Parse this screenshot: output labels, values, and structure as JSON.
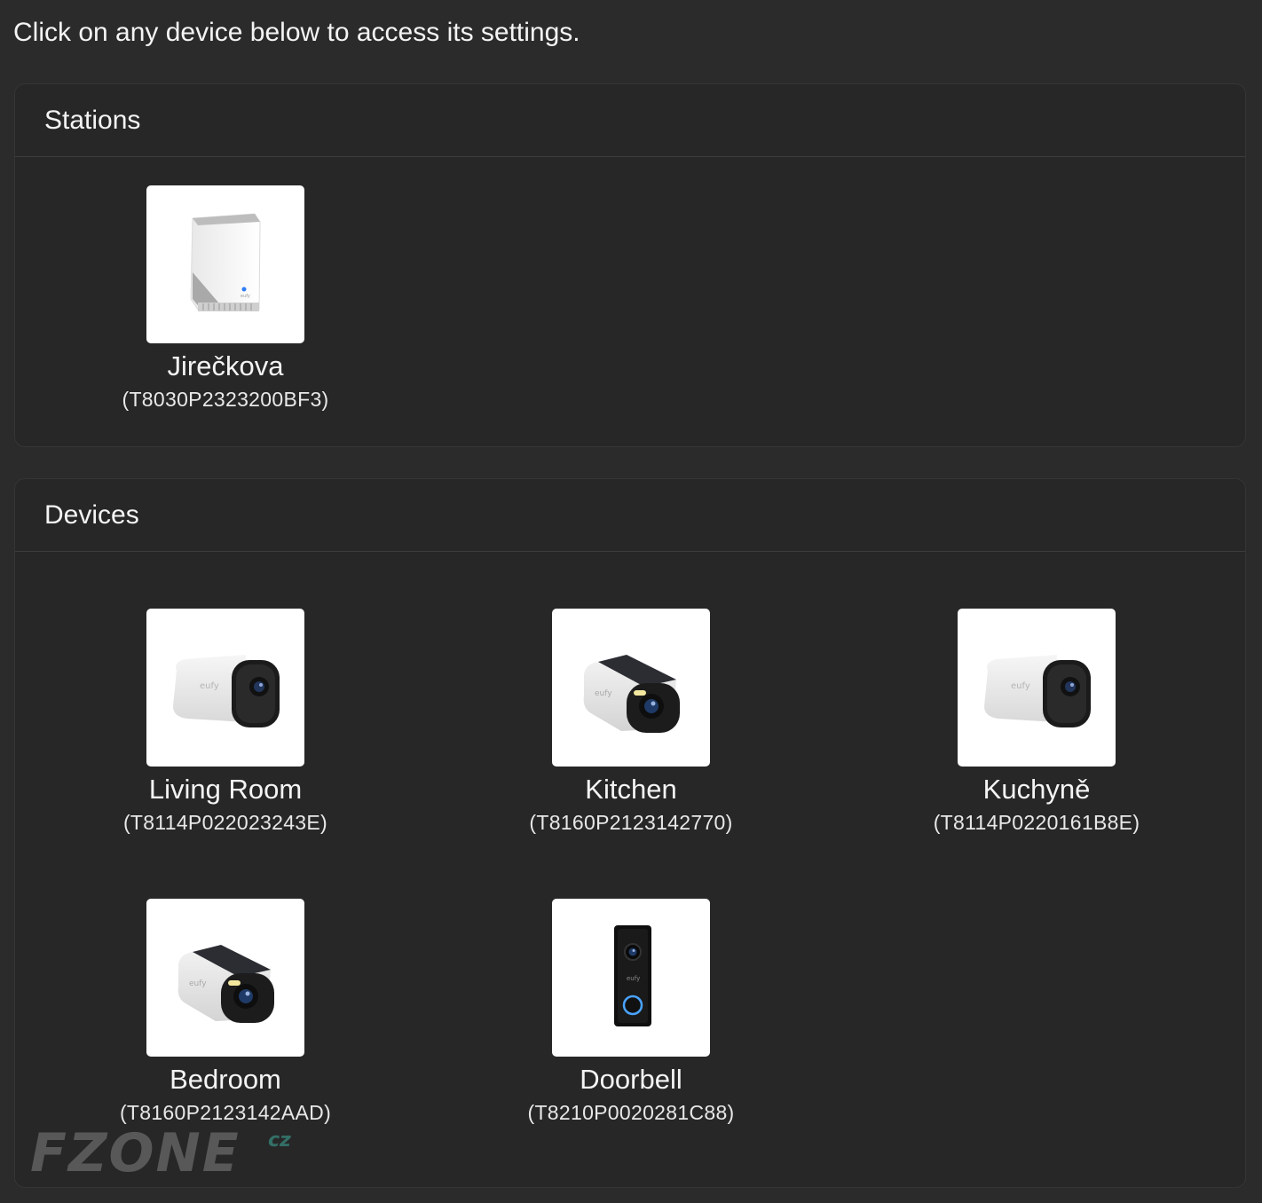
{
  "intro_text": "Click on any device below to access its settings.",
  "stations": {
    "title": "Stations",
    "items": [
      {
        "name": "Jirečkova",
        "serial": "(T8030P2323200BF3)",
        "icon": "homebase-station-icon"
      }
    ]
  },
  "devices": {
    "title": "Devices",
    "items": [
      {
        "name": "Living Room",
        "serial": "(T8114P022023243E)",
        "icon": "eufycam-2-pro-icon"
      },
      {
        "name": "Kitchen",
        "serial": "(T8160P2123142770)",
        "icon": "eufycam-3-icon"
      },
      {
        "name": "Kuchyně",
        "serial": "(T8114P0220161B8E)",
        "icon": "eufycam-2-pro-icon"
      },
      {
        "name": "Bedroom",
        "serial": "(T8160P2123142AAD)",
        "icon": "eufycam-3-icon"
      },
      {
        "name": "Doorbell",
        "serial": "(T8210P0020281C88)",
        "icon": "video-doorbell-icon"
      }
    ]
  },
  "watermark": {
    "text": "FZONE",
    "suffix": "cz"
  }
}
